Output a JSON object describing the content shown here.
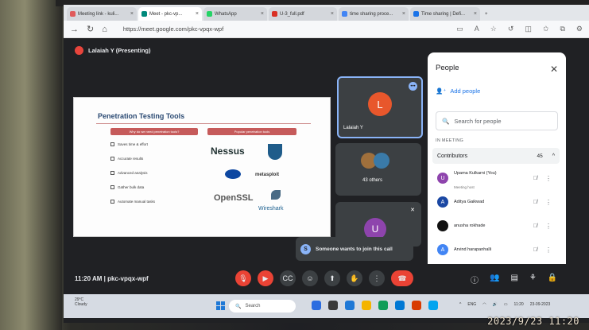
{
  "browser": {
    "tabs": [
      {
        "label": "Meeting link - kuli...",
        "color": "#e05a5a"
      },
      {
        "label": "Meet - pkc-vp...",
        "color": "#00897b",
        "active": true
      },
      {
        "label": "WhatsApp",
        "color": "#25d366"
      },
      {
        "label": "U-3_full.pdf",
        "color": "#d93025"
      },
      {
        "label": "time sharing proce...",
        "color": "#4285f4"
      },
      {
        "label": "Time sharing | Defi...",
        "color": "#1a73e8"
      }
    ],
    "url": "https://meet.google.com/pkc-vpqx-wpf"
  },
  "meet": {
    "presenter": "Lalaiah Y (Presenting)",
    "slide": {
      "title": "Penetration Testing Tools",
      "left_pill": "Why do we need penetration tools?",
      "right_pill": "Popular penetration tools",
      "checklist": [
        "Saves time & effort",
        "Accurate results",
        "Advanced analysis",
        "Gather bulk data",
        "Automate manual tasks"
      ],
      "logos": [
        "Nessus",
        "metasploit",
        "OpenSSL",
        "Wireshark"
      ]
    },
    "tiles": {
      "main_initial": "L",
      "main_name": "Lalaiah Y",
      "others_label": "43 others",
      "bottom_initial": "U"
    },
    "toast": "Someone wants to join this call",
    "meeting_info": "11:20 AM  |  pkc-vpqx-wpf"
  },
  "people": {
    "title": "People",
    "add_people": "Add people",
    "search_placeholder": "Search for people",
    "in_meeting": "IN MEETING",
    "contributors": "Contributors",
    "contributor_count": "45",
    "participants": [
      {
        "initial": "U",
        "name": "Upama Kulkarni (You)",
        "sub": "Meeting host",
        "color": "#8e44ad"
      },
      {
        "initial": "A",
        "name": "Aditya Gaikwad",
        "sub": "",
        "color": "#1a47a3"
      },
      {
        "initial": "",
        "name": "anusha rokhade",
        "sub": "",
        "color": "#111111"
      },
      {
        "initial": "A",
        "name": "Arvind harapanhalli",
        "sub": "",
        "color": "#4285f4"
      }
    ]
  },
  "taskbar": {
    "weather_temp": "29°C",
    "weather_desc": "Cloudy",
    "search": "Search",
    "lang": "ENG",
    "time": "11:20",
    "date": "23-09-2023"
  },
  "photo_stamp": "2023/9/23  11:20"
}
